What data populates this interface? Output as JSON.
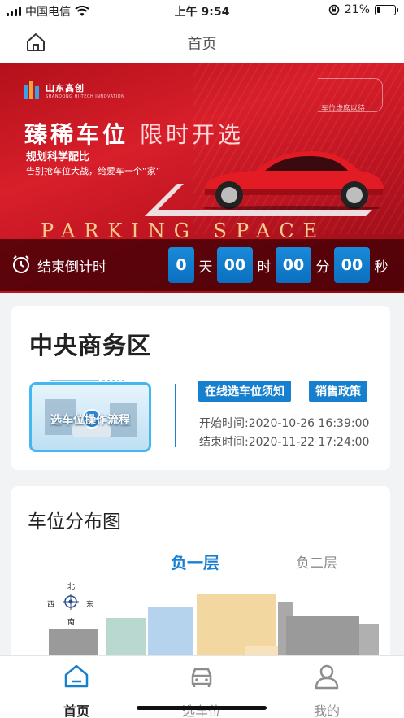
{
  "status_bar": {
    "carrier": "中国电信",
    "time": "上午 9:54",
    "battery": "21%",
    "battery_level": 0.21
  },
  "nav": {
    "title": "首页"
  },
  "banner": {
    "logo_text": "山东高创",
    "logo_sub": "SHANDONG HI-TECH INNOVATION",
    "corner_text": "车位虚席以待",
    "headline_main": "臻稀车位",
    "headline_accent": "限时开选",
    "subtitle": "规划科学配比",
    "tagline": "告别抢车位大战，给爱车一个“家”",
    "english": "PARKING SPACE",
    "countdown": {
      "label": "结束倒计时",
      "days": "0",
      "days_unit": "天",
      "hours": "00",
      "hours_unit": "时",
      "minutes": "00",
      "minutes_unit": "分",
      "seconds": "00",
      "seconds_unit": "秒"
    }
  },
  "project": {
    "name": "中央商务区",
    "video_caption": "选车位操作流程",
    "buttons": {
      "notice": "在线选车位须知",
      "policy": "销售政策"
    },
    "start_time": "开始时间:2020-10-26 16:39:00",
    "end_time": "结束时间:2020-11-22 17:24:00"
  },
  "distribution": {
    "title": "车位分布图",
    "floors": [
      "负一层",
      "负二层"
    ],
    "active_floor": "负一层",
    "compass": {
      "north": "北",
      "south": "南",
      "west": "西",
      "east": "东"
    }
  },
  "tab_bar": {
    "items": [
      {
        "label": "首页",
        "icon": "home-icon",
        "active": true
      },
      {
        "label": "选车位",
        "icon": "car-icon",
        "active": false
      },
      {
        "label": "我的",
        "icon": "user-icon",
        "active": false
      }
    ]
  },
  "colors": {
    "accent": "#1680cf",
    "banner_red": "#c01522",
    "countdown_blue": "#0b6fc0"
  }
}
